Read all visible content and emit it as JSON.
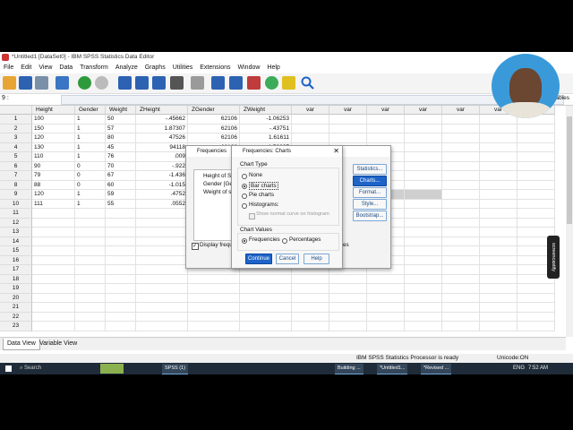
{
  "window": {
    "title": "*Untitled1 [DataSet0] - IBM SPSS Statistics Data Editor"
  },
  "menu": [
    "File",
    "Edit",
    "View",
    "Data",
    "Transform",
    "Analyze",
    "Graphs",
    "Utilities",
    "Extensions",
    "Window",
    "Help"
  ],
  "cellref": {
    "label": "9 :",
    "right_text": "ables"
  },
  "columns": [
    "Height",
    "Gender",
    "Weight",
    "ZHeight",
    "ZGender",
    "ZWeight",
    "var",
    "var",
    "var",
    "var",
    "var",
    "var",
    "var"
  ],
  "rows": [
    {
      "n": "1",
      "v": [
        "100",
        "1",
        "50",
        "-.45662",
        "62106",
        "-1.06253"
      ]
    },
    {
      "n": "2",
      "v": [
        "150",
        "1",
        "57",
        "1.87307",
        "62106",
        "-.43751"
      ]
    },
    {
      "n": "3",
      "v": [
        "120",
        "1",
        "80",
        "47526",
        "62106",
        "1.61611"
      ]
    },
    {
      "n": "4",
      "v": [
        "130",
        "1",
        "45",
        "94118",
        "62106",
        "-1.50897"
      ]
    },
    {
      "n": "5",
      "v": [
        "110",
        "1",
        "76",
        ".009",
        "",
        ""
      ]
    },
    {
      "n": "6",
      "v": [
        "90",
        "0",
        "70",
        "-.922",
        "",
        ""
      ]
    },
    {
      "n": "7",
      "v": [
        "79",
        "0",
        "67",
        "-1.436",
        "",
        ""
      ]
    },
    {
      "n": "8",
      "v": [
        "88",
        "0",
        "60",
        "-1.015",
        "",
        ""
      ]
    },
    {
      "n": "9",
      "v": [
        "120",
        "1",
        "59",
        ".4752",
        "",
        ""
      ]
    },
    {
      "n": "10",
      "v": [
        "111",
        "1",
        "55",
        ".0552",
        "",
        ""
      ]
    },
    {
      "n": "11",
      "v": [
        "",
        "",
        "",
        "",
        "",
        ""
      ]
    },
    {
      "n": "12",
      "v": [
        "",
        "",
        "",
        "",
        "",
        ""
      ]
    },
    {
      "n": "13",
      "v": [
        "",
        "",
        "",
        "",
        "",
        ""
      ]
    },
    {
      "n": "14",
      "v": [
        "",
        "",
        "",
        "",
        "",
        ""
      ]
    },
    {
      "n": "15",
      "v": [
        "",
        "",
        "",
        "",
        "",
        ""
      ]
    },
    {
      "n": "16",
      "v": [
        "",
        "",
        "",
        "",
        "",
        ""
      ]
    },
    {
      "n": "17",
      "v": [
        "",
        "",
        "",
        "",
        "",
        ""
      ]
    },
    {
      "n": "18",
      "v": [
        "",
        "",
        "",
        "",
        "",
        ""
      ]
    },
    {
      "n": "19",
      "v": [
        "",
        "",
        "",
        "",
        "",
        ""
      ]
    },
    {
      "n": "20",
      "v": [
        "",
        "",
        "",
        "",
        "",
        ""
      ]
    },
    {
      "n": "21",
      "v": [
        "",
        "",
        "",
        "",
        "",
        ""
      ]
    },
    {
      "n": "22",
      "v": [
        "",
        "",
        "",
        "",
        "",
        ""
      ]
    },
    {
      "n": "23",
      "v": [
        "",
        "",
        "",
        "",
        "",
        ""
      ]
    }
  ],
  "tabs": {
    "data_view": "Data View",
    "variable_view": "Variable View"
  },
  "status": {
    "processor": "IBM SPSS Statistics Processor is ready",
    "unicode": "Unicode:ON"
  },
  "taskbar": {
    "search": "Search",
    "items": [
      "SPSS (1)",
      "Building ...",
      "*Untitled1...",
      "*Revised ..."
    ],
    "lang": "ENG",
    "time": "7:52 AM"
  },
  "freq_dialog": {
    "title": "Frequencies",
    "vars": [
      "Height of St",
      "Gender [Gen",
      "Weight of st"
    ],
    "display_label": "Display frequ",
    "side_buttons": [
      "Statistics...",
      "Charts...",
      "Format...",
      "Style...",
      "Bootstrap..."
    ],
    "partial": "es"
  },
  "charts_dialog": {
    "title": "Frequencies: Charts",
    "chart_type_label": "Chart Type",
    "options": [
      "None",
      "Bar charts",
      "Pie charts",
      "Histograms:"
    ],
    "selected_option": "Bar charts",
    "normal_curve": "Show normal curve on histogram",
    "chart_values_label": "Chart Values",
    "values": [
      "Frequencies",
      "Percentages"
    ],
    "selected_value": "Frequencies",
    "buttons": {
      "continue": "Continue",
      "cancel": "Cancel",
      "help": "Help"
    }
  },
  "watermark": "screencastify",
  "colors": {
    "accent": "#1e64c8",
    "taskbar": "#1f2b38"
  }
}
